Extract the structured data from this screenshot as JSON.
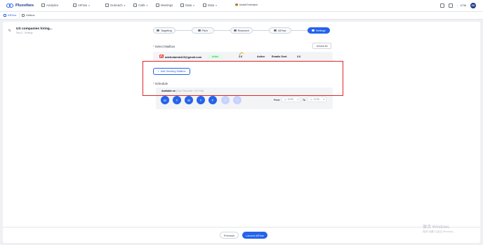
{
  "app": {
    "name": "Plusvibes"
  },
  "topnav": {
    "items": [
      {
        "label": "Analytics",
        "icon": "chart-icon",
        "dropdown": false
      },
      {
        "label": "AIFlow",
        "icon": "flow-icon",
        "dropdown": true
      },
      {
        "label": "Outreach",
        "icon": "send-icon",
        "dropdown": true
      },
      {
        "label": "Calls",
        "icon": "phone-icon",
        "dropdown": true
      },
      {
        "label": "Meetings",
        "icon": "calendar-icon",
        "dropdown": false
      },
      {
        "label": "Data",
        "icon": "database-icon",
        "dropdown": true
      },
      {
        "label": "Data",
        "icon": "database-icon",
        "dropdown": true
      }
    ],
    "install_label": "Install Extension",
    "credits": "4736",
    "avatar_initials": "OD"
  },
  "subnav": {
    "tabs": [
      {
        "label": "AIFlow",
        "active": true
      },
      {
        "label": "Unibox",
        "active": false
      }
    ]
  },
  "campaign": {
    "title": "US companies hiring...",
    "subtitle": "Step 5 - Settings"
  },
  "steps": [
    {
      "label": "Targeting",
      "active": false
    },
    {
      "label": "Pitch",
      "active": false
    },
    {
      "label": "Research",
      "active": false
    },
    {
      "label": "AIFlow",
      "active": false
    },
    {
      "label": "Settings",
      "active": true
    }
  ],
  "mailbox_section": {
    "title": "Select Mailbox",
    "unlock_label": "Unlock All",
    "mailbox": {
      "email": "adebolamia419@gmail.com",
      "status": "Active",
      "score": "2.6",
      "state": "Active",
      "emails_sent_label": "Emails Sent",
      "emails_sent_value": "2.6"
    },
    "add_label": "Add Sending Mailbox"
  },
  "schedule": {
    "title": "Schedule",
    "available_on": "Available on",
    "timezone": "(Your Timezone: UTC+08)",
    "days": [
      {
        "label": "M",
        "enabled": true
      },
      {
        "label": "T",
        "enabled": true
      },
      {
        "label": "W",
        "enabled": true
      },
      {
        "label": "T",
        "enabled": true
      },
      {
        "label": "F",
        "enabled": true
      },
      {
        "label": "S",
        "enabled": false
      },
      {
        "label": "S",
        "enabled": false
      }
    ],
    "from_label": "From",
    "from_value": "10:00",
    "to_label": "To",
    "to_value": "17:00"
  },
  "footer": {
    "previous_label": "Previous",
    "launch_label": "Launch AIFlow"
  },
  "watermark": {
    "line1": "激活 Windows",
    "line2": "转到\"设置\"以激活 Windows。"
  },
  "colors": {
    "primary": "#2563eb",
    "highlight": "#dc2626",
    "active_green": "#16a34a"
  }
}
